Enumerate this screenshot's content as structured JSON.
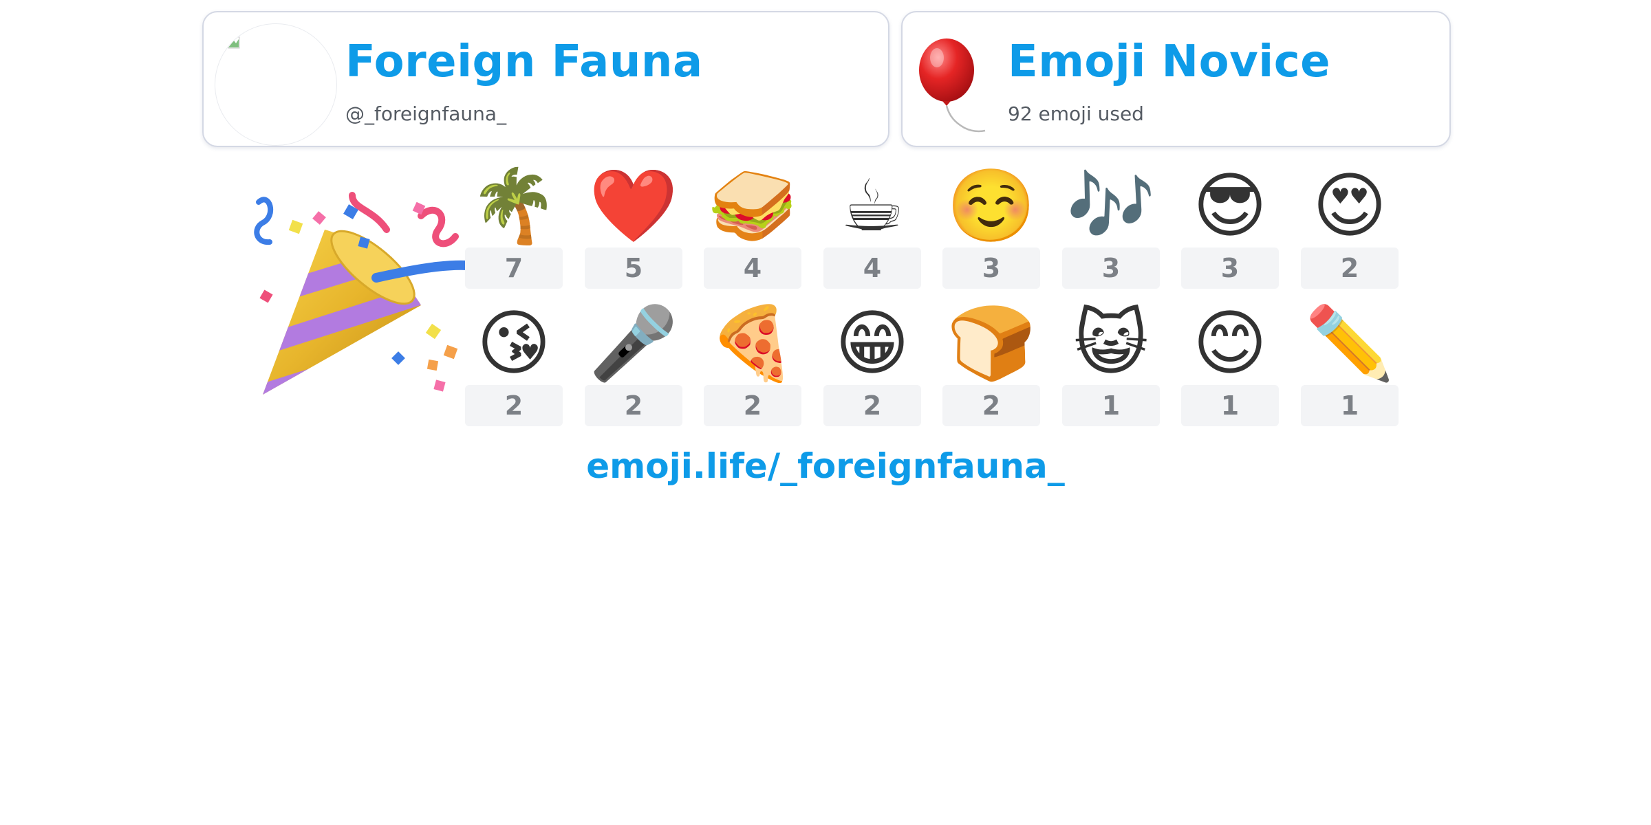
{
  "profile": {
    "name": "Foreign Fauna",
    "handle": "@_foreignfauna_"
  },
  "rank": {
    "title": "Emoji Novice",
    "emoji_used": "92 emoji used",
    "icon": "balloon-icon"
  },
  "decoration_icon": "party-popper-icon",
  "colors": {
    "accent": "#0e9be8",
    "muted_text": "#555b63",
    "count_text": "#7c8086",
    "count_bg": "#f3f4f6",
    "card_border": "#d4d8e4"
  },
  "emoji_counts": [
    {
      "emoji": "🌴",
      "name": "palm-tree-icon",
      "count": "7"
    },
    {
      "emoji": "❤️",
      "name": "red-heart-icon",
      "count": "5"
    },
    {
      "emoji": "🥪",
      "name": "sandwich-icon",
      "count": "4"
    },
    {
      "emoji": "☕",
      "name": "hot-beverage-icon",
      "count": "4"
    },
    {
      "emoji": "☺️",
      "name": "smiling-face-icon",
      "count": "3"
    },
    {
      "emoji": "🎶",
      "name": "musical-notes-icon",
      "count": "3"
    },
    {
      "emoji": "😎",
      "name": "sunglasses-face-icon",
      "count": "3"
    },
    {
      "emoji": "😍",
      "name": "heart-eyes-face-icon",
      "count": "2"
    },
    {
      "emoji": "😘",
      "name": "face-blowing-kiss-icon",
      "count": "2"
    },
    {
      "emoji": "🎤",
      "name": "microphone-icon",
      "count": "2"
    },
    {
      "emoji": "🍕",
      "name": "pizza-icon",
      "count": "2"
    },
    {
      "emoji": "😁",
      "name": "beaming-face-icon",
      "count": "2"
    },
    {
      "emoji": "🍞",
      "name": "bread-icon",
      "count": "2"
    },
    {
      "emoji": "😺",
      "name": "grinning-cat-icon",
      "count": "1"
    },
    {
      "emoji": "😊",
      "name": "smiling-eyes-face-icon",
      "count": "1"
    },
    {
      "emoji": "✏️",
      "name": "pencil-icon",
      "count": "1"
    }
  ],
  "link": {
    "text": "emoji.life/_foreignfauna_"
  }
}
